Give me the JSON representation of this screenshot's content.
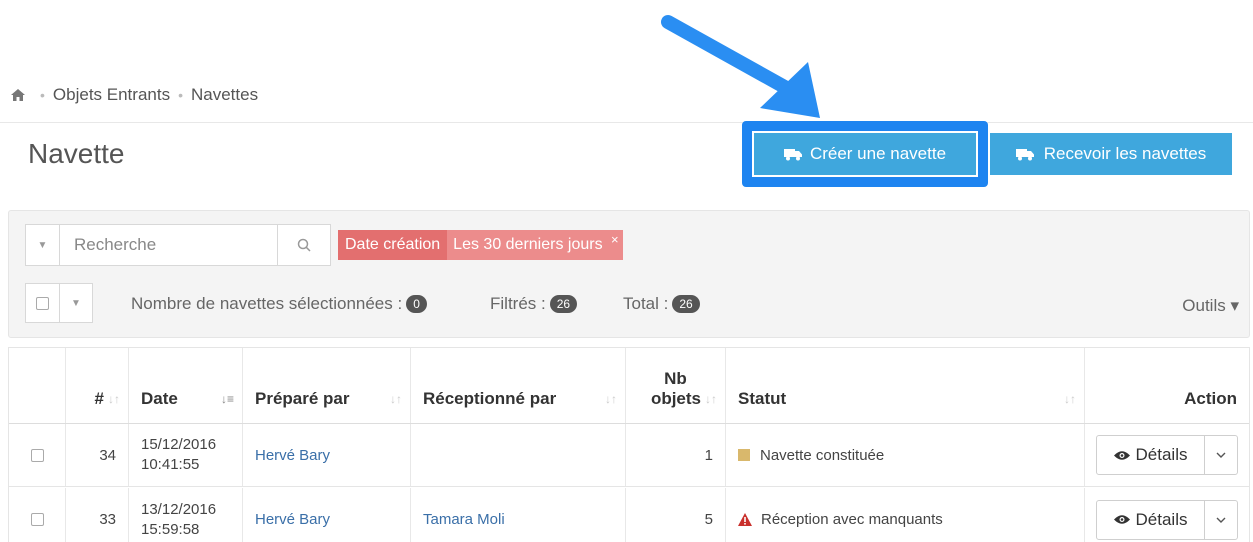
{
  "breadcrumb": {
    "items": [
      "Objets Entrants",
      "Navettes"
    ],
    "home_icon": "home-icon"
  },
  "page": {
    "title": "Navette"
  },
  "actions": {
    "create_label": "Créer une navette",
    "receive_label": "Recevoir les navettes",
    "accent_color": "#3fa7dd",
    "highlight_color": "#1e84f0"
  },
  "filters": {
    "search_placeholder": "Recherche",
    "tag_key": "Date création",
    "tag_value": "Les 30 derniers jours",
    "tag_remove": "×",
    "selected_label": "Nombre de navettes sélectionnées :",
    "selected_count": "0",
    "filtered_label": "Filtrés :",
    "filtered_count": "26",
    "total_label": "Total :",
    "total_count": "26",
    "tools_label": "Outils ▾"
  },
  "table": {
    "headers": {
      "num": "#",
      "date": "Date",
      "prepared_by": "Préparé par",
      "received_by": "Réceptionné par",
      "nb_objects_1": "Nb",
      "nb_objects_2": "objets",
      "status": "Statut",
      "action": "Action"
    },
    "rows": [
      {
        "id": "34",
        "date": "15/12/2016",
        "time": "10:41:55",
        "prepared_by": "Hervé Bary",
        "received_by": "",
        "nb_objects": "1",
        "status": "Navette constituée",
        "status_icon": "square-icon",
        "action_label": "Détails"
      },
      {
        "id": "33",
        "date": "13/12/2016",
        "time": "15:59:58",
        "prepared_by": "Hervé Bary",
        "received_by": "Tamara Moli",
        "nb_objects": "5",
        "status": "Réception avec manquants",
        "status_icon": "warning-icon",
        "action_label": "Détails"
      }
    ]
  }
}
